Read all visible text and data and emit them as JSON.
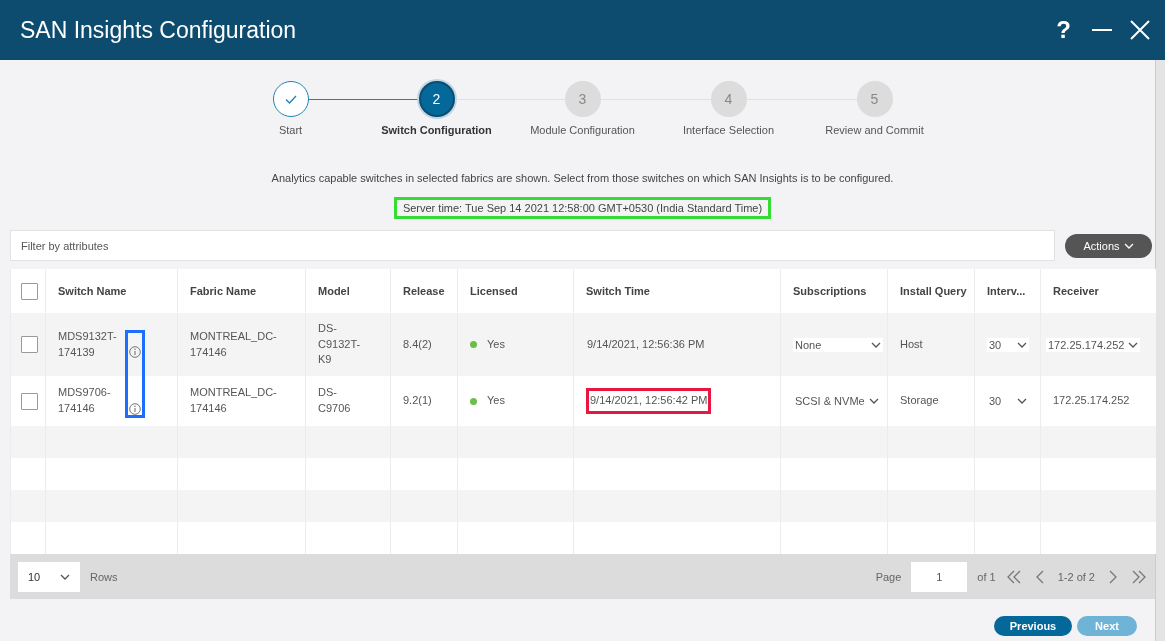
{
  "window": {
    "title": "SAN Insights Configuration",
    "controls": [
      {
        "kind": "help",
        "label": "?"
      },
      {
        "kind": "minimize"
      },
      {
        "kind": "close"
      }
    ]
  },
  "steps": [
    {
      "label": "Start",
      "completed": true,
      "selected": false
    },
    {
      "number": "2",
      "label": "Switch Configuration",
      "completed": false,
      "selected": true
    },
    {
      "number": "3",
      "label": "Module Configuration",
      "completed": false,
      "selected": false
    },
    {
      "number": "4",
      "label": "Interface Selection",
      "completed": false,
      "selected": false
    },
    {
      "number": "5",
      "label": "Review and Commit",
      "completed": false,
      "selected": false
    }
  ],
  "description": "Analytics capable switches in selected fabrics are shown. Select from those switches on which SAN Insights is to be configured.",
  "server_time": {
    "text": "Server time: Tue Sep 14 2021 12:58:00 GMT+0530 (India Standard Time)",
    "highlight": {
      "color": "#33dd33"
    }
  },
  "filter": {
    "placeholder": "Filter by attributes"
  },
  "actions_button": "Actions",
  "table": {
    "select_all_checked": false,
    "columns": [
      "Switch Name",
      "Fabric Name",
      "Model",
      "Release",
      "Licensed",
      "Switch Time",
      "Subscriptions",
      "Install Query",
      "Interv...",
      "Receiver"
    ],
    "rows": [
      {
        "checked": false,
        "switch_name": "MDS9132T-174139",
        "fabric_name": "MONTREAL_DC-174146",
        "model": "DS-C9132T-K9",
        "release": "8.4(2)",
        "licensed": {
          "text": "Yes",
          "color": "#6abf4b"
        },
        "switch_time": {
          "text": "9/14/2021, 12:56:36 PM"
        },
        "subscriptions": "None",
        "install_query": "Host",
        "interval": "30",
        "receiver": "172.25.174.252",
        "receiver_dropdown": true
      },
      {
        "checked": false,
        "switch_name": "MDS9706-174146",
        "fabric_name": "MONTREAL_DC-174146",
        "model": "DS-C9706",
        "release": "9.2(1)",
        "licensed": {
          "text": "Yes",
          "color": "#6abf4b"
        },
        "switch_time": {
          "text": "9/14/2021, 12:56:42 PM",
          "highlight": {
            "color": "#e8173f"
          }
        },
        "subscriptions": "SCSI & NVMe",
        "install_query": "Storage",
        "interval": "30",
        "receiver": "172.25.174.252",
        "receiver_dropdown": false
      }
    ],
    "info_icons_highlight": {
      "color": "#1a6fff"
    }
  },
  "pagination": {
    "page_size": "10",
    "rows_label": "Rows",
    "page_label": "Page",
    "page": "1",
    "of_label": "of 1",
    "range": "1-2 of 2"
  },
  "buttons": [
    {
      "label": "Previous",
      "disabled": false
    },
    {
      "label": "Next",
      "disabled": true
    }
  ]
}
